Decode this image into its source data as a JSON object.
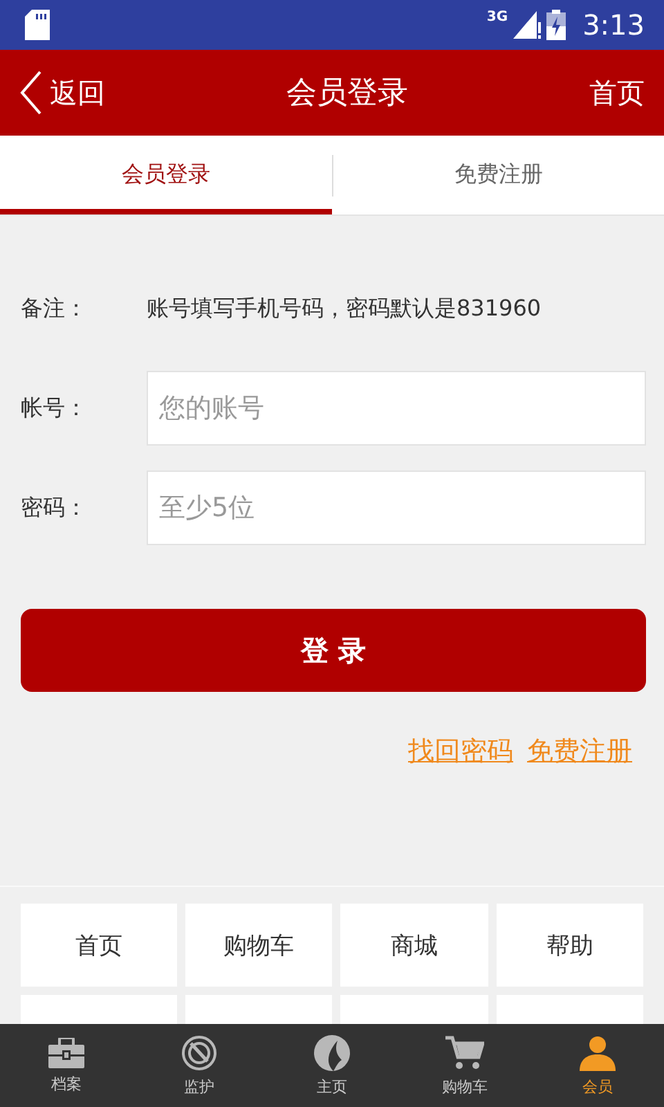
{
  "status_bar": {
    "network": "3G",
    "time": "3:13"
  },
  "header": {
    "back": "返回",
    "title": "会员登录",
    "home": "首页"
  },
  "tabs": [
    {
      "label": "会员登录",
      "selected": true
    },
    {
      "label": "免费注册",
      "selected": false
    }
  ],
  "note": {
    "label": "备注：",
    "text": "账号填写手机号码，密码默认是831960"
  },
  "fields": [
    {
      "label": "帐号：",
      "placeholder": "您的账号"
    },
    {
      "label": "密码：",
      "placeholder": "至少5位"
    }
  ],
  "login_button": "登 录",
  "links": [
    "找回密码",
    "免费注册"
  ],
  "grid": [
    "首页",
    "购物车",
    "商城",
    "帮助"
  ],
  "bottom_nav": [
    {
      "label": "档案",
      "selected": false
    },
    {
      "label": "监护",
      "selected": false
    },
    {
      "label": "主页",
      "selected": false
    },
    {
      "label": "购物车",
      "selected": false
    },
    {
      "label": "会员",
      "selected": true
    }
  ]
}
